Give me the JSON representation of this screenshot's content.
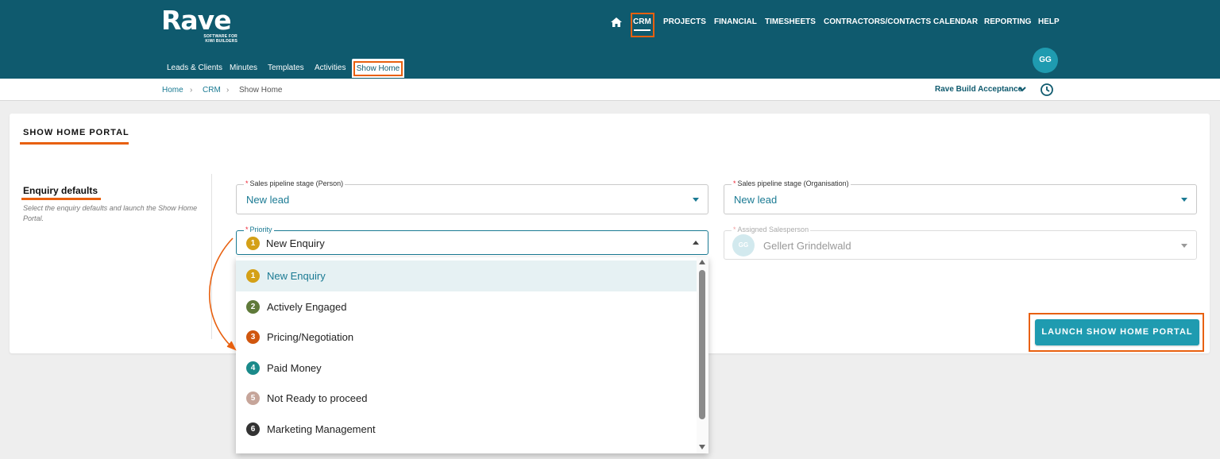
{
  "brand": {
    "name": "Rave",
    "tagline_line1": "SOFTWARE FOR",
    "tagline_line2": "KIWI BUILDERS"
  },
  "topnav": [
    {
      "label": "CRM"
    },
    {
      "label": "PROJECTS"
    },
    {
      "label": "FINANCIAL"
    },
    {
      "label": "TIMESHEETS"
    },
    {
      "label": "CONTRACTORS/CONTACTS"
    },
    {
      "label": "CALENDAR"
    },
    {
      "label": "REPORTING"
    },
    {
      "label": "HELP"
    }
  ],
  "subnav": [
    {
      "label": "Leads & Clients"
    },
    {
      "label": "Minutes"
    },
    {
      "label": "Templates"
    },
    {
      "label": "Activities"
    },
    {
      "label": "Show Home"
    }
  ],
  "user": {
    "initials": "GG"
  },
  "breadcrumb": {
    "home": "Home",
    "sep": "›",
    "crm": "CRM",
    "current": "Show Home"
  },
  "environment": {
    "label": "Rave Build Acceptance"
  },
  "card": {
    "title": "SHOW HOME PORTAL",
    "section_title": "Enquiry defaults",
    "section_desc": "Select the enquiry defaults and launch the Show Home Portal."
  },
  "fields": {
    "pipeline_person": {
      "label": "Sales pipeline stage (Person)",
      "required": "*",
      "value": "New lead"
    },
    "pipeline_org": {
      "label": "Sales pipeline stage (Organisation)",
      "required": "*",
      "value": "New lead"
    },
    "priority": {
      "label": "Priority",
      "required": "*",
      "value": "New Enquiry",
      "badge": "1"
    },
    "salesperson": {
      "label": "Assigned Salesperson",
      "required": "*",
      "value": "Gellert Grindelwald",
      "initials": "GG"
    }
  },
  "launch_button": {
    "label": "LAUNCH SHOW HOME PORTAL"
  },
  "priority_options": [
    {
      "num": "1",
      "label": "New Enquiry",
      "color": "#d4a017"
    },
    {
      "num": "2",
      "label": "Actively Engaged",
      "color": "#5f7a3a"
    },
    {
      "num": "3",
      "label": "Pricing/Negotiation",
      "color": "#d0560e"
    },
    {
      "num": "4",
      "label": "Paid Money",
      "color": "#1a8a8a"
    },
    {
      "num": "5",
      "label": "Not Ready to proceed",
      "color": "#c6a59a"
    },
    {
      "num": "6",
      "label": "Marketing Management",
      "color": "#333333"
    }
  ],
  "colors": {
    "header": "#0f5a6e",
    "accent": "#1f9bb0",
    "highlight": "#e8600f"
  }
}
